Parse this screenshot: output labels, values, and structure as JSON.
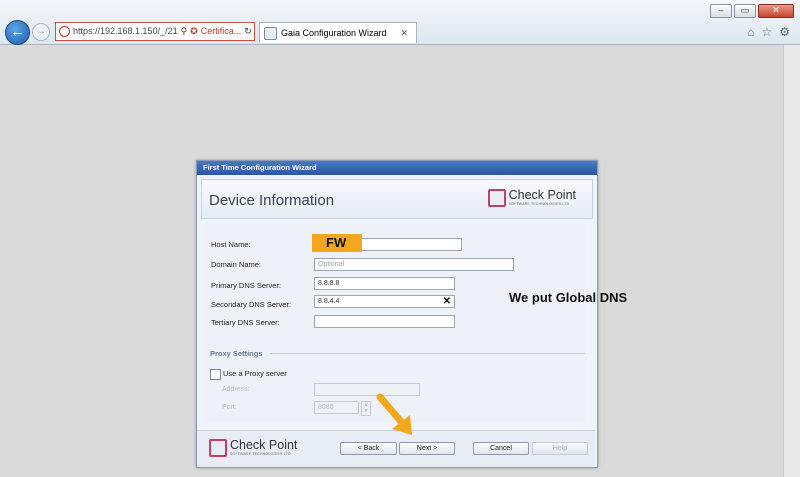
{
  "browser": {
    "address": "https://192.168.1.150/_/21",
    "cert_label": "Certifica...",
    "tab_title": "Gaia Configuration Wizard",
    "tab_close": "✕",
    "back": "←",
    "forward": "→",
    "win_min": "–",
    "win_max": "▭",
    "win_close": "✕",
    "home": "⌂",
    "favorites": "☆",
    "settings": "⚙"
  },
  "wizard": {
    "title_bar": "First Time Configuration Wizard",
    "heading": "Device Information",
    "logo_text": "Check Point",
    "logo_sub": "SOFTWARE TECHNOLOGIES LTD.",
    "fields": {
      "host_name_label": "Host Name:",
      "host_name_value": "",
      "domain_name_label": "Domain Name:",
      "domain_name_placeholder": "Optional",
      "primary_dns_label": "Primary DNS Server:",
      "primary_dns_value": "8.8.8.8",
      "secondary_dns_label": "Secondary DNS Server:",
      "secondary_dns_value": "8.8.4.4",
      "tertiary_dns_label": "Tertiary DNS Server:",
      "tertiary_dns_value": ""
    },
    "proxy": {
      "section_title": "Proxy Settings",
      "use_proxy_label": "Use a Proxy server",
      "address_label": "Address:",
      "port_label": "Port:",
      "port_value": "8080"
    },
    "buttons": {
      "back": "< Back",
      "next": "Next >",
      "cancel": "Cancel",
      "help": "Help"
    }
  },
  "annotations": {
    "fw_label": "FW",
    "note": "We put Global DNS"
  }
}
